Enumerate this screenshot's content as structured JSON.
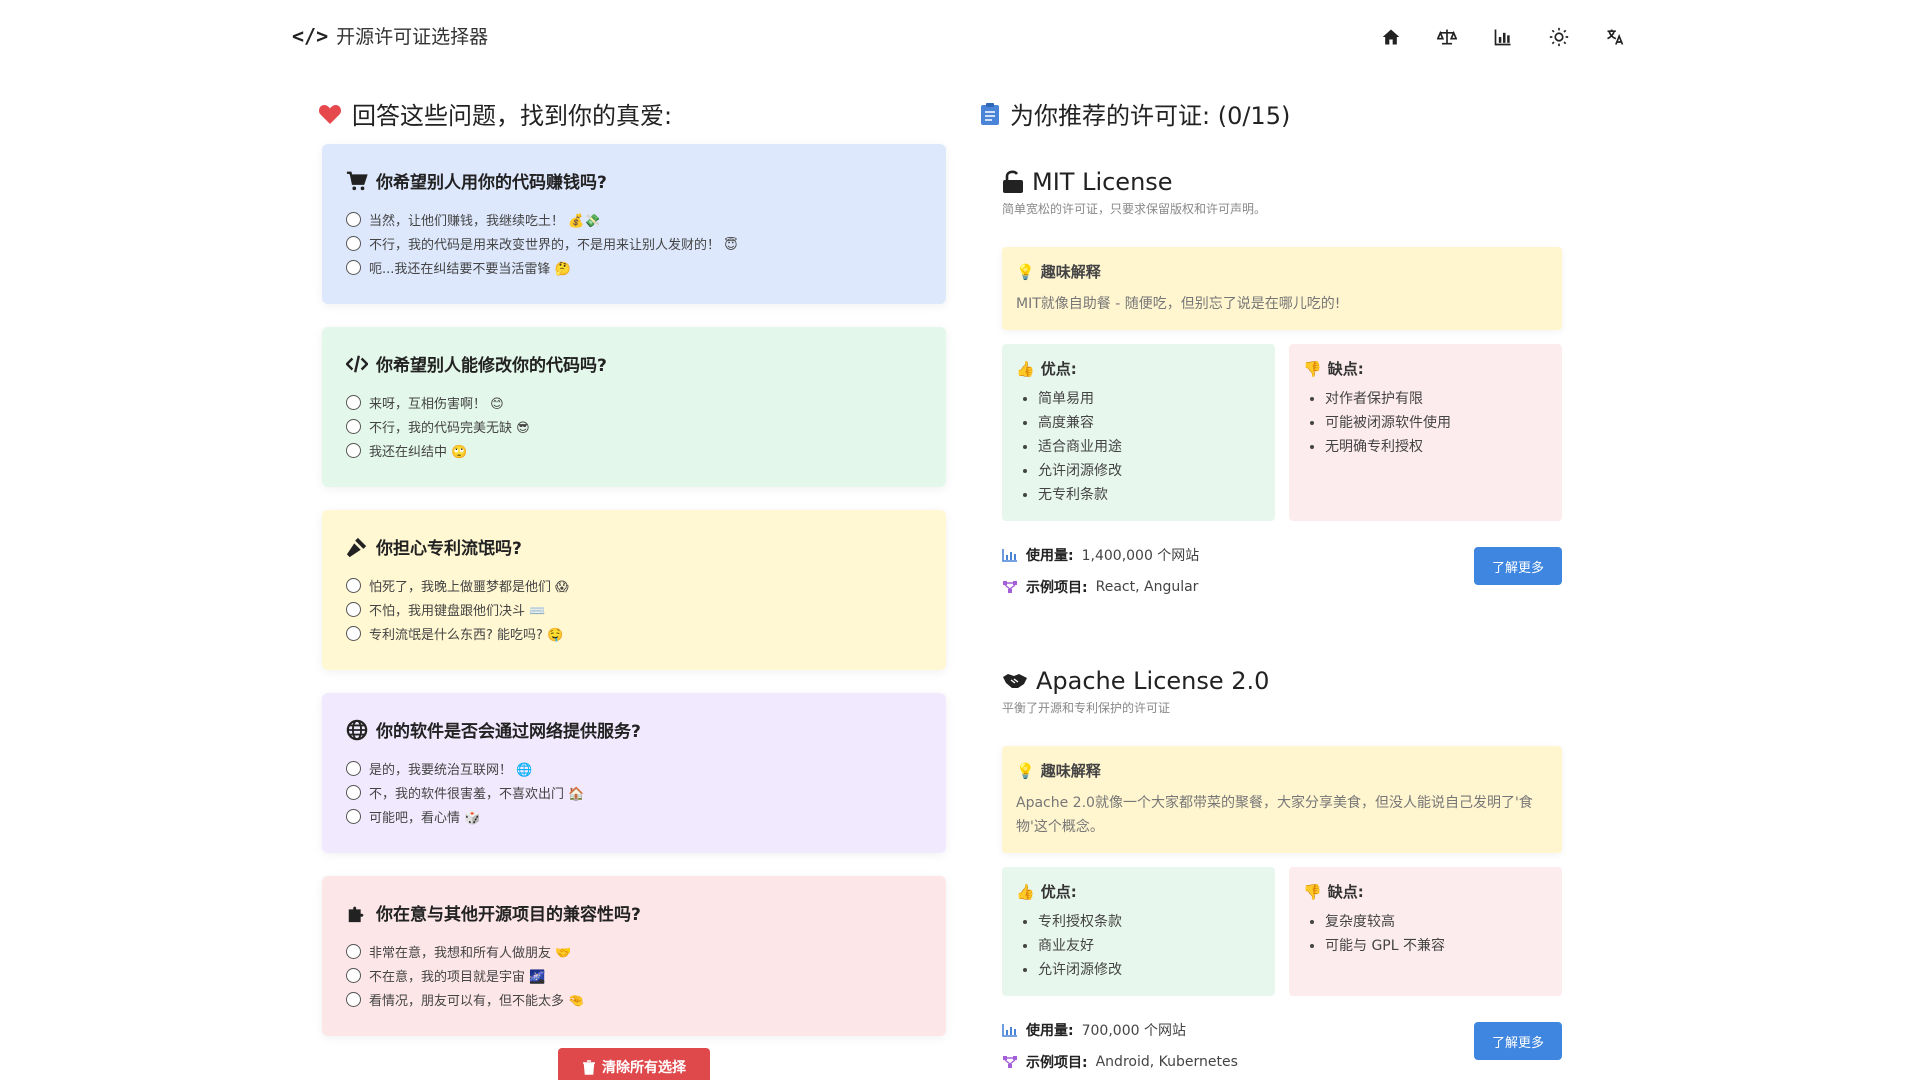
{
  "nav": {
    "brand": "开源许可证选择器",
    "icons": [
      "home-icon",
      "balance-scale-icon",
      "chart-icon",
      "sun-icon",
      "translate-icon"
    ]
  },
  "left": {
    "title": "回答这些问题，找到你的真爱:",
    "questions": [
      {
        "title": "你希望别人用你的代码赚钱吗?",
        "icon": "cart-icon",
        "bg": "#dde8fd",
        "options": [
          "当然，让他们赚钱，我继续吃土！ 💰💸",
          "不行，我的代码是用来改变世界的，不是用来让别人发财的！ 😇",
          "呃...我还在纠结要不要当活雷锋 🤔"
        ]
      },
      {
        "title": "你希望别人能修改你的代码吗?",
        "icon": "code-icon",
        "bg": "#e3f7ea",
        "options": [
          "来呀，互相伤害啊！ 😊",
          "不行，我的代码完美无缺 😎",
          "我还在纠结中 🙄"
        ]
      },
      {
        "title": "你担心专利流氓吗?",
        "icon": "gavel-icon",
        "bg": "#fff8d2",
        "options": [
          "怕死了，我晚上做噩梦都是他们 😱",
          "不怕，我用键盘跟他们决斗 ⌨️",
          "专利流氓是什么东西? 能吃吗? 🤤"
        ]
      },
      {
        "title": "你的软件是否会通过网络提供服务?",
        "icon": "globe-icon",
        "bg": "#f1e9fd",
        "options": [
          "是的，我要统治互联网！ 🌐",
          "不，我的软件很害羞，不喜欢出门 🏠",
          "可能吧，看心情 🎲"
        ]
      },
      {
        "title": "你在意与其他开源项目的兼容性吗?",
        "icon": "puzzle-icon",
        "bg": "#fde6e8",
        "options": [
          "非常在意，我想和所有人做朋友 🤝",
          "不在意，我的项目就是宇宙 🌌",
          "看情况，朋友可以有，但不能太多 🤏"
        ]
      }
    ],
    "clear_label": "清除所有选择"
  },
  "right": {
    "title": "为你推荐的许可证: (0/15)",
    "licenses": [
      {
        "name": "MIT License",
        "icon": "unlock-icon",
        "desc": "简单宽松的许可证，只要求保留版权和许可声明。",
        "fun_title": "趣味解释",
        "fun_text": "MIT就像自助餐 - 随便吃，但别忘了说是在哪儿吃的!",
        "pros_title": "优点:",
        "pros": [
          "简单易用",
          "高度兼容",
          "适合商业用途",
          "允许闭源修改",
          "无专利条款"
        ],
        "cons_title": "缺点:",
        "cons": [
          "对作者保护有限",
          "可能被闭源软件使用",
          "无明确专利授权"
        ],
        "usage_label": "使用量:",
        "usage": "1,400,000 个网站",
        "examples_label": "示例项目:",
        "examples": "React, Angular",
        "learn_label": "了解更多"
      },
      {
        "name": "Apache License 2.0",
        "icon": "handshake-icon",
        "desc": "平衡了开源和专利保护的许可证",
        "fun_title": "趣味解释",
        "fun_text": "Apache 2.0就像一个大家都带菜的聚餐，大家分享美食，但没人能说自己发明了'食物'这个概念。",
        "pros_title": "优点:",
        "pros": [
          "专利授权条款",
          "商业友好",
          "允许闭源修改"
        ],
        "cons_title": "缺点:",
        "cons": [
          "复杂度较高",
          "可能与 GPL 不兼容"
        ],
        "usage_label": "使用量:",
        "usage": "700,000 个网站",
        "examples_label": "示例项目:",
        "examples": "Android, Kubernetes",
        "learn_label": "了解更多"
      }
    ]
  },
  "colors": {
    "accent": "#3f86e0",
    "danger": "#e0494c",
    "fun_bg": "#fff5cf",
    "pros_bg": "#e8f7ee",
    "cons_bg": "#fdecee"
  }
}
